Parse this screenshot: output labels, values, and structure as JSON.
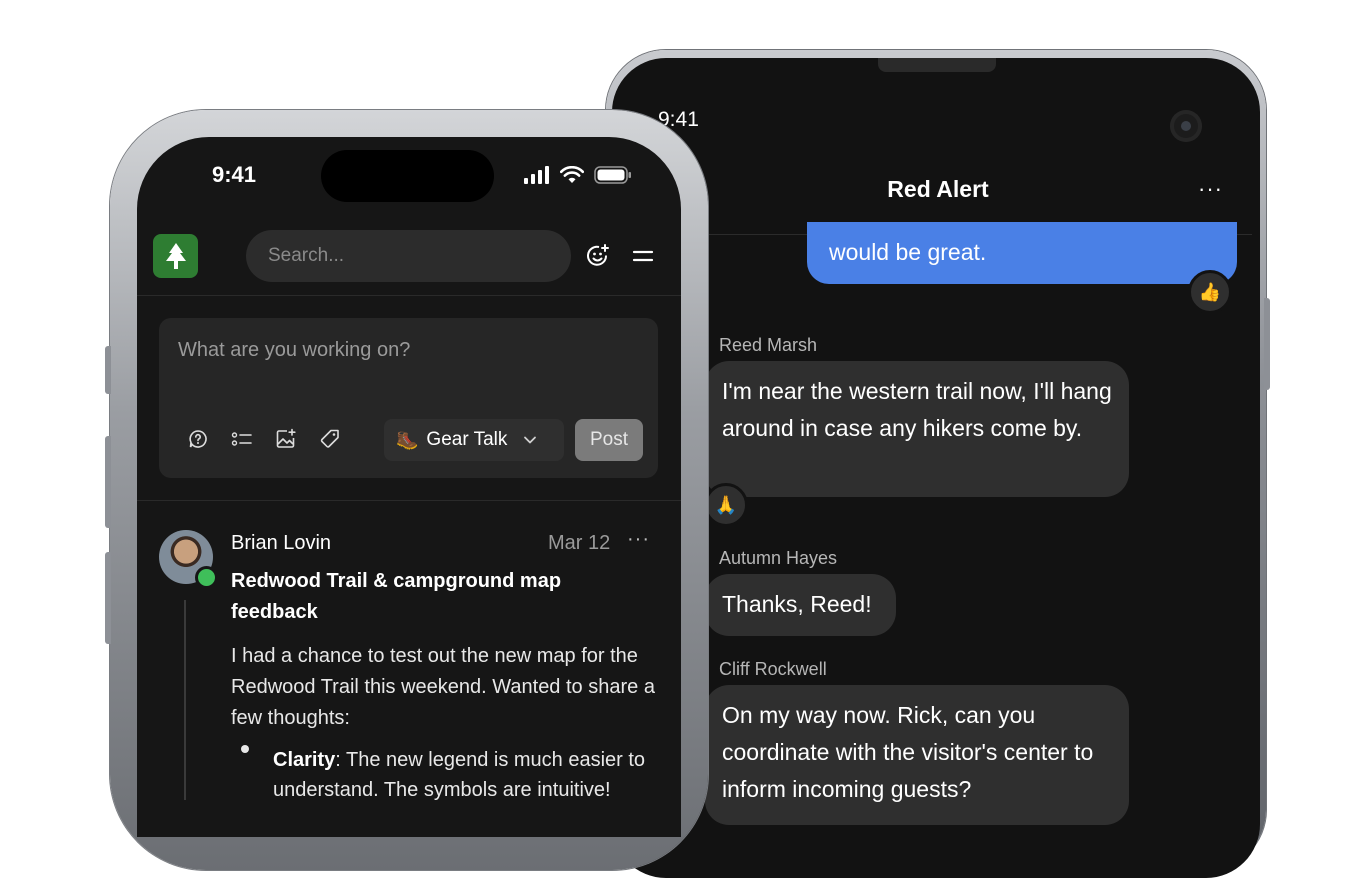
{
  "android": {
    "time": "9:41",
    "chat_title": "Red Alert",
    "more": "···",
    "messages": [
      {
        "text": "would be great.",
        "reaction": "👍"
      },
      {
        "sender": "Reed Marsh",
        "text": "I'm near the western trail now, I'll hang around in case any hikers come by.",
        "reaction": "🙏"
      },
      {
        "sender": "Autumn Hayes",
        "text": "Thanks, Reed!"
      },
      {
        "sender": "Cliff Rockwell",
        "text": "On my way now. Rick, can you coordinate with the visitor's center to inform incoming guests?"
      }
    ]
  },
  "iphone": {
    "time": "9:41",
    "search_placeholder": "Search...",
    "composer_placeholder": "What are you working on?",
    "channel_label": "Gear Talk",
    "channel_emoji": "🥾",
    "post_label": "Post",
    "post": {
      "author": "Brian Lovin",
      "date": "Mar 12",
      "more": "···",
      "title": "Redwood Trail & campground map feedback",
      "body": "I had a chance to test out the new map for the Redwood Trail this weekend. Wanted to share a few thoughts:",
      "bullets": [
        {
          "label": "Clarity",
          "text": ": The new legend is much easier to understand. The symbols are intuitive!"
        }
      ]
    }
  }
}
